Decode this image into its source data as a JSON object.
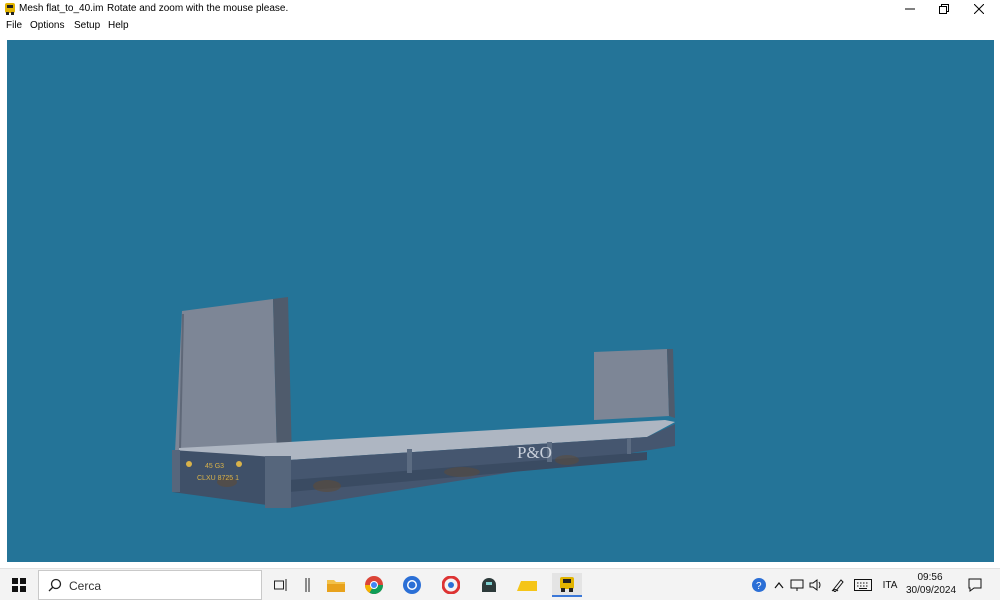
{
  "window": {
    "title": "Mesh flat_to_40.im",
    "hint": "Rotate and zoom with the mouse please."
  },
  "menu": {
    "items": [
      "File",
      "Options",
      "Setup",
      "Help"
    ]
  },
  "viewport": {
    "background_color": "#247498",
    "model": {
      "brand_text": "P&O",
      "panel_label_1": "45 G3",
      "panel_label_2": "CLXU 8725 1"
    }
  },
  "taskbar": {
    "search_placeholder": "Cerca",
    "language": "ITA",
    "time": "09:56",
    "date": "30/09/2024"
  },
  "colors": {
    "accent": "#3b78d8",
    "container_blue": "#40536e",
    "deck": "#aeb6c2"
  }
}
